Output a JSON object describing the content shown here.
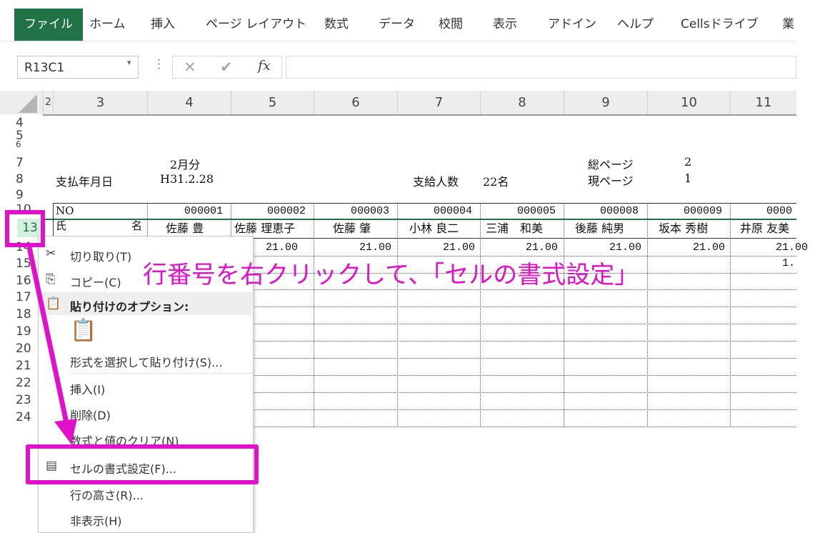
{
  "ribbon": {
    "tabs": [
      "ファイル",
      "ホーム",
      "挿入",
      "ページ レイアウト",
      "数式",
      "データ",
      "校閲",
      "表示",
      "アドイン",
      "ヘルプ",
      "Cellsドライブ",
      "業"
    ]
  },
  "formula_bar": {
    "name_box": "R13C1",
    "fx_label": "fx",
    "cancel_icon": "✕",
    "enter_icon": "✔"
  },
  "columns": [
    "2",
    "3",
    "4",
    "5",
    "6",
    "7",
    "8",
    "9",
    "10",
    "11"
  ],
  "rows": [
    "4",
    "5",
    "6",
    "7",
    "8",
    "9",
    "10",
    "13",
    "14",
    "15",
    "16",
    "17",
    "18",
    "19",
    "20",
    "21",
    "22",
    "23",
    "24"
  ],
  "sheet": {
    "month": "2月分",
    "pay_date_label": "支払年月日",
    "pay_date_value": "H31.2.28",
    "headcount_label": "支給人数",
    "headcount_value": "22名",
    "total_pages_label": "総ページ",
    "total_pages_value": "2",
    "current_page_label": "現ページ",
    "current_page_value": "1",
    "no_label": "NO",
    "name_label_1": "氏",
    "name_label_2": "名",
    "employee_numbers": [
      "000001",
      "000002",
      "000003",
      "000004",
      "000005",
      "000008",
      "000009",
      "0000"
    ],
    "employee_names": [
      "佐藤 豊",
      "佐藤 理恵子",
      "佐藤 肇",
      "小林 良二",
      "三浦　和美",
      "後藤 純男",
      "坂本 秀樹",
      "井原 友美"
    ],
    "row14_values": [
      "21.00",
      "21.00",
      "21.00",
      "21.00",
      "21.00",
      "21.00",
      "21.00",
      "21."
    ],
    "row15_values": [
      "1."
    ]
  },
  "context_menu": {
    "cut": "切り取り(T)",
    "copy": "コピー(C)",
    "paste_options": "貼り付けのオプション:",
    "paste_special": "形式を選択して貼り付け(S)...",
    "insert": "挿入(I)",
    "delete": "削除(D)",
    "clear": "数式と値のクリア(N)",
    "format_cells": "セルの書式設定(F)...",
    "row_height": "行の高さ(R)...",
    "hide": "非表示(H)"
  },
  "annotation": {
    "text": "行番号を右クリックして、「セルの書式設定」",
    "color": "#e011c8"
  },
  "colors": {
    "file_tab": "#217346",
    "selected_row": "#d3f0e0"
  }
}
